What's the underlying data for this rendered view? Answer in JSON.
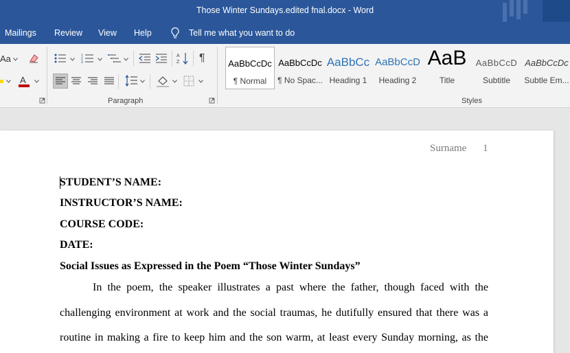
{
  "window": {
    "title": "Those Winter Sundays.edited fnal.docx  -  Word"
  },
  "menu": {
    "items": [
      "Mailings",
      "Review",
      "View",
      "Help"
    ],
    "tell_me": "Tell me what you want to do"
  },
  "ribbon": {
    "font_partial": {
      "change_case": "Aa"
    },
    "groups": {
      "paragraph": "Paragraph",
      "styles": "Styles"
    },
    "styles": [
      {
        "preview": "AaBbCcDc",
        "label": "¶ Normal"
      },
      {
        "preview": "AaBbCcDc",
        "label": "¶ No Spac..."
      },
      {
        "preview": "AaBbCc",
        "label": "Heading 1"
      },
      {
        "preview": "AaBbCcD",
        "label": "Heading 2"
      },
      {
        "preview": "AaB",
        "label": "Title"
      },
      {
        "preview": "AaBbCcD",
        "label": "Subtitle"
      },
      {
        "preview": "AaBbCcDc",
        "label": "Subtle Em..."
      }
    ],
    "colors": {
      "font_color": "#c00000",
      "highlight": "#ffff00",
      "accent": "#2b579a",
      "heading": "#2e74b5"
    }
  },
  "document": {
    "header": {
      "surname": "Surname",
      "page_number": "1"
    },
    "fields": [
      "STUDENT’S NAME:",
      "INSTRUCTOR’S NAME:",
      "COURSE CODE:",
      "DATE:"
    ],
    "heading": "Social Issues as Expressed in the Poem “Those Winter Sundays”",
    "paragraph_lines": [
      "In the poem, the speaker illustrates a past where the father, though faced with the",
      "challenging environment at work and the social traumas, he dutifully ensured that there was a",
      "routine in making a fire to keep him and the son warm, at least every Sunday morning, as the"
    ]
  }
}
